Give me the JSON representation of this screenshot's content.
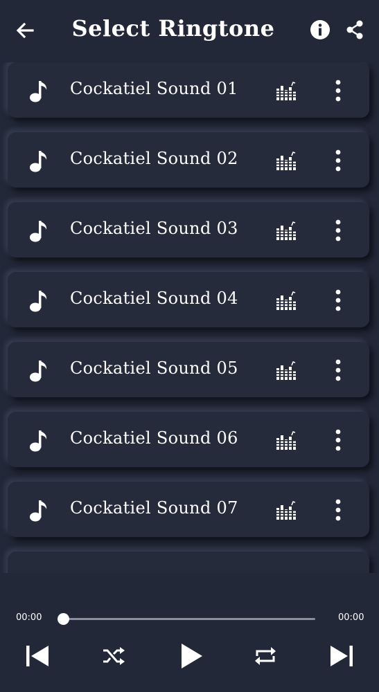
{
  "header": {
    "title": "Select Ringtone",
    "back_icon": "arrow-left-icon",
    "info_icon": "info-icon",
    "share_icon": "share-icon"
  },
  "ringtones": [
    {
      "name": "Cockatiel Sound 01"
    },
    {
      "name": "Cockatiel Sound 02"
    },
    {
      "name": "Cockatiel Sound 03"
    },
    {
      "name": "Cockatiel Sound 04"
    },
    {
      "name": "Cockatiel Sound 05"
    },
    {
      "name": "Cockatiel Sound 06"
    },
    {
      "name": "Cockatiel Sound 07"
    },
    {
      "name": ""
    }
  ],
  "player": {
    "current_time": "00:00",
    "total_time": "00:00",
    "progress": 0
  },
  "colors": {
    "background": "#232838",
    "card": "#262b3b",
    "foreground": "#ffffff"
  }
}
